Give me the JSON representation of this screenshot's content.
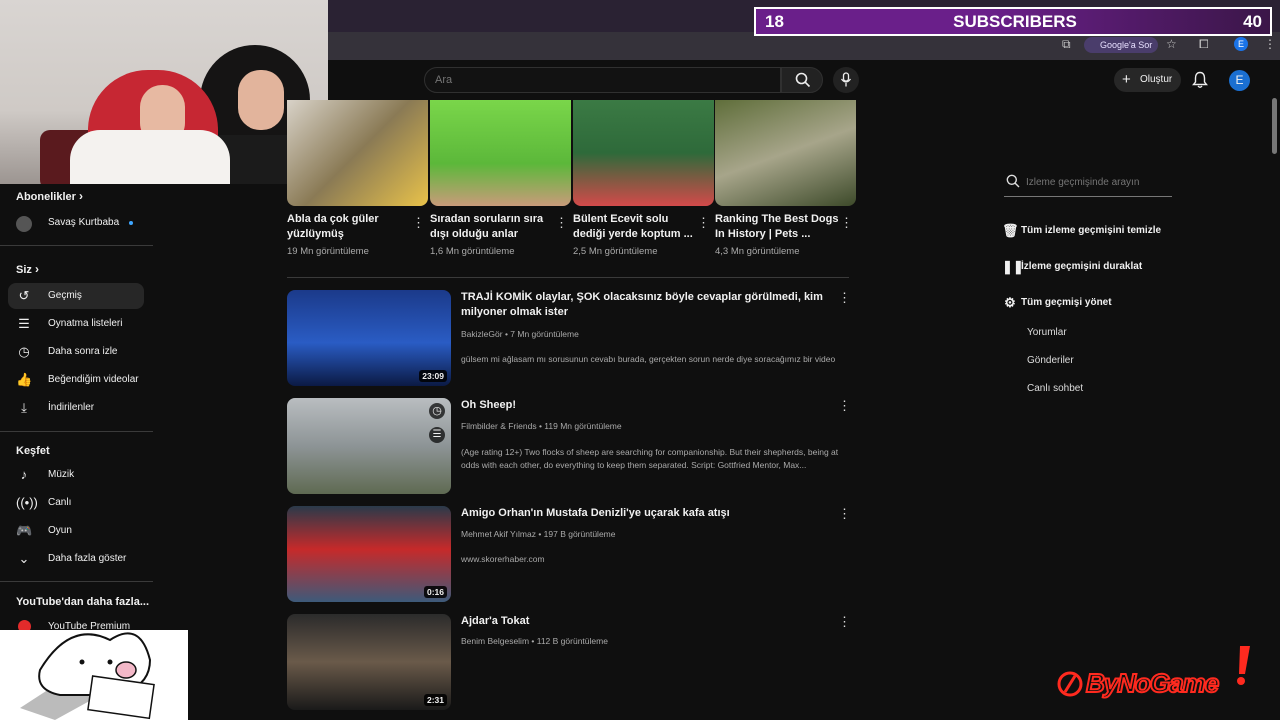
{
  "stream_overlay": {
    "subscriber_count": "18",
    "subscriber_label": "SUBSCRIBERS",
    "subscriber_goal": "40",
    "brand_logo": "ByNoGame"
  },
  "browser": {
    "google_sor": "Google'a Sor",
    "profile_initial": "E"
  },
  "header": {
    "search_placeholder": "Ara",
    "create_label": "Oluştur",
    "user_initial": "E"
  },
  "sidebar": {
    "subscriptions_title": "Abonelikler",
    "subscriptions": [
      {
        "label": "Savaş Kurtbaba"
      }
    ],
    "you_title": "Siz",
    "you_items": [
      {
        "label": "Geçmiş",
        "icon": "history-icon",
        "active": true
      },
      {
        "label": "Oynatma listeleri",
        "icon": "playlist-icon"
      },
      {
        "label": "Daha sonra izle",
        "icon": "clock-icon"
      },
      {
        "label": "Beğendiğim videolar",
        "icon": "thumbs-up-icon"
      },
      {
        "label": "İndirilenler",
        "icon": "download-icon"
      }
    ],
    "explore_title": "Keşfet",
    "explore_items": [
      {
        "label": "Müzik",
        "icon": "music-icon"
      },
      {
        "label": "Canlı",
        "icon": "live-icon"
      },
      {
        "label": "Oyun",
        "icon": "gamepad-icon"
      },
      {
        "label": "Daha fazla göster",
        "icon": "chevron-down-icon"
      }
    ],
    "more_title": "YouTube'dan daha fazla...",
    "more_items": [
      {
        "label": "YouTube Premium"
      }
    ]
  },
  "shorts": [
    {
      "title": "Abla da çok güler yüzlüymüş",
      "views": "19 Mn görüntüleme"
    },
    {
      "title": "Sıradan soruların sıra dışı olduğu anlar",
      "views": "1,6 Mn görüntüleme"
    },
    {
      "title": "Bülent Ecevit solu dediği yerde koptum ...",
      "views": "2,5 Mn görüntüleme"
    },
    {
      "title": "Ranking The Best Dogs In History | Pets ...",
      "views": "4,3 Mn görüntüleme"
    }
  ],
  "videos": [
    {
      "title": "TRAJİ KOMİK olaylar, ŞOK olacaksınız böyle cevaplar görülmedi, kim milyoner olmak ister",
      "channel": "BakizleGör",
      "views": "7 Mn görüntüleme",
      "description": "gülsem mi ağlasam mı sorusunun cevabı burada, gerçekten sorun nerde diye soracağımız bir video",
      "duration": "23:09"
    },
    {
      "title": "Oh Sheep!",
      "channel": "Filmbilder & Friends",
      "views": "119 Mn görüntüleme",
      "description": "(Age rating 12+) Two flocks of sheep are searching for companionship. But their shepherds, being at odds with each other, do everything to keep them separated. Script: Gottfried Mentor, Max...",
      "duration": ""
    },
    {
      "title": "Amigo Orhan'ın Mustafa Denizli'ye uçarak kafa atışı",
      "channel": "Mehmet Akif Yılmaz",
      "views": "197 B görüntüleme",
      "description": "www.skorerhaber.com",
      "duration": "0:16"
    },
    {
      "title": "Ajdar'a Tokat",
      "channel": "Benim Belgeselim",
      "views": "112 B görüntüleme",
      "description": "",
      "duration": "2:31"
    }
  ],
  "history_panel": {
    "search_placeholder": "İzleme geçmişinde arayın",
    "clear_label": "Tüm izleme geçmişini temizle",
    "pause_label": "İzleme geçmişini duraklat",
    "manage_label": "Tüm geçmişi yönet",
    "sub_items": [
      "Yorumlar",
      "Gönderiler",
      "Canlı sohbet"
    ]
  },
  "colors": {
    "accent": "#6a1f8a",
    "background": "#0f0f0f",
    "logo_red": "#ff2a1f"
  }
}
